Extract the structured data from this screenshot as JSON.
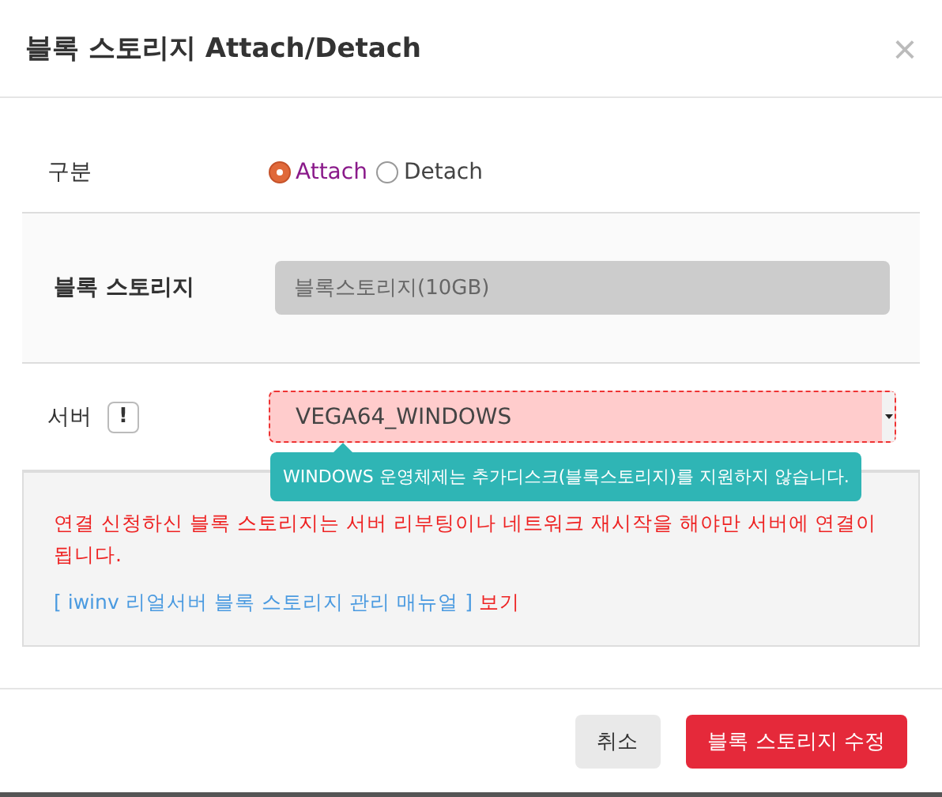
{
  "dialog": {
    "title": "블록 스토리지 Attach/Detach",
    "close": "×"
  },
  "fields": [
    {
      "kind": "radio",
      "label": "구분",
      "options": [
        {
          "label": "Attach",
          "selected": true
        },
        {
          "label": "Detach",
          "selected": false
        }
      ]
    },
    {
      "kind": "readonly",
      "label": "블록 스토리지",
      "value": "블록스토리지(10GB)"
    },
    {
      "kind": "select",
      "label": "서버",
      "badge": "!",
      "value": "VEGA64_WINDOWS",
      "invalid": true,
      "tooltip": "WINDOWS 운영체제는 추가디스크(블록스토리지)를 지원하지 않습니다."
    }
  ],
  "notice": {
    "message": "연결 신청하신 블록 스토리지는 서버 리부팅이나 네트워크 재시작을 해야만 서버에 연결이 됩니다.",
    "manual_link": "[ iwinv 리얼서버 블록 스토리지 관리 매뉴얼 ]",
    "view_link": "보기"
  },
  "buttons": [
    {
      "label": "취소",
      "kind": "secondary"
    },
    {
      "label": "블록 스토리지 수정",
      "kind": "primary"
    }
  ]
}
